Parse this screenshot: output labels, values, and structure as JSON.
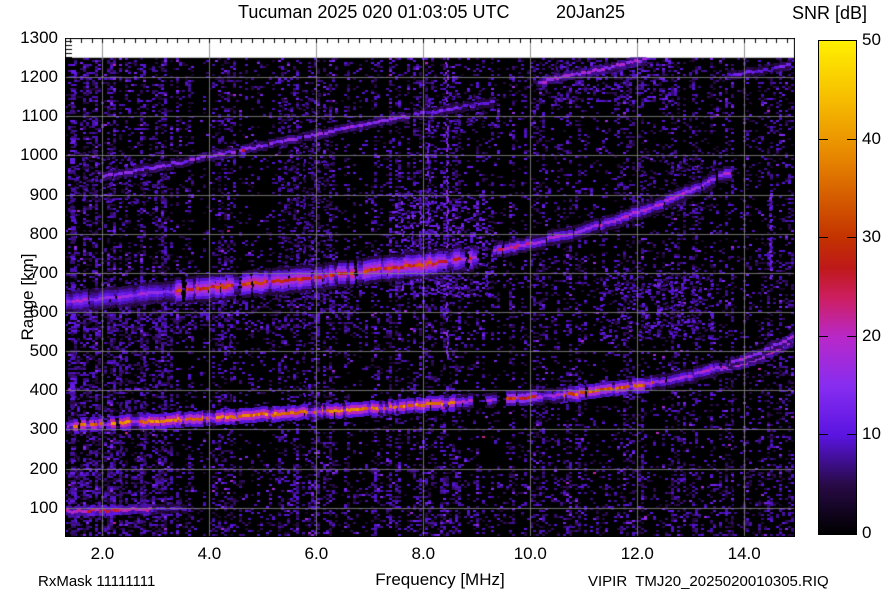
{
  "header": {
    "title": "Tucuman 2025 020 01:03:05 UTC",
    "date": "20Jan25"
  },
  "colorbar": {
    "title": "SNR [dB]",
    "tick_labels": [
      "0",
      "10",
      "20",
      "30",
      "40",
      "50"
    ],
    "tick_values": [
      0,
      10,
      20,
      30,
      40,
      50
    ],
    "mark_values": [
      10,
      20,
      30,
      40
    ]
  },
  "footer": {
    "left": "RxMask 11111111",
    "right": "VIPIR  TMJ20_2025020010305.RIQ"
  },
  "chart_data": {
    "type": "heatmap",
    "title": "Tucuman 2025 020 01:03:05 UTC",
    "xlabel": "Frequency [MHz]",
    "ylabel": "Range [km]",
    "zlabel": "SNR [dB]",
    "xlim": [
      1.3,
      14.95
    ],
    "ylim": [
      25,
      1300
    ],
    "zlim": [
      0,
      50
    ],
    "grid": true,
    "grid_color_rgba": "rgba(128,128,128,0.85)",
    "x_tick_labels": [
      "2.0",
      "4.0",
      "6.0",
      "8.0",
      "10.0",
      "12.0",
      "14.0"
    ],
    "x_tick_values": [
      2,
      4,
      6,
      8,
      10,
      12,
      14
    ],
    "x_minor_step": 0.2,
    "y_tick_labels": [
      "100",
      "200",
      "300",
      "400",
      "500",
      "600",
      "700",
      "800",
      "900",
      "1000",
      "1100",
      "1200",
      "1300"
    ],
    "y_tick_values": [
      100,
      200,
      300,
      400,
      500,
      600,
      700,
      800,
      900,
      1000,
      1100,
      1200,
      1300
    ],
    "data_top_km": 1250,
    "background_color": "#000000",
    "colormap_stops": [
      [
        0,
        0,
        0,
        0
      ],
      [
        5,
        40,
        10,
        70
      ],
      [
        10,
        90,
        20,
        225
      ],
      [
        15,
        135,
        45,
        240
      ],
      [
        20,
        185,
        40,
        200
      ],
      [
        24,
        205,
        30,
        95
      ],
      [
        27,
        190,
        25,
        25
      ],
      [
        30,
        195,
        50,
        0
      ],
      [
        38,
        230,
        132,
        0
      ],
      [
        44,
        246,
        188,
        0
      ],
      [
        50,
        255,
        240,
        0
      ]
    ],
    "noise": {
      "seed": 1337,
      "base_density": 0.16,
      "band_gains": [
        {
          "f0": 1.3,
          "f1": 3.2,
          "gain": 1.6
        },
        {
          "f0": 5.4,
          "f1": 6.3,
          "gain": 1.25
        },
        {
          "f0": 7.3,
          "f1": 8.8,
          "gain": 1.3
        },
        {
          "f0": 11.9,
          "f1": 13.3,
          "gain": 1.2
        },
        {
          "f0": 13.9,
          "f1": 14.95,
          "gain": 1.15
        }
      ],
      "row_gains": [
        {
          "r0": 25,
          "r1": 215,
          "gain": 1.5
        },
        {
          "r0": 530,
          "r1": 760,
          "gain": 1.3
        },
        {
          "r0": 1090,
          "r1": 1250,
          "gain": 1.2
        }
      ]
    },
    "traces": [
      {
        "name": "F-region first hop",
        "points": [
          [
            1.3,
            311
          ],
          [
            2,
            316
          ],
          [
            3,
            323
          ],
          [
            4,
            331
          ],
          [
            5,
            339
          ],
          [
            6,
            347
          ],
          [
            7,
            355
          ],
          [
            8,
            364
          ],
          [
            9,
            373
          ],
          [
            10,
            383
          ],
          [
            10.8,
            393
          ],
          [
            11.6,
            406
          ],
          [
            12.4,
            422
          ],
          [
            13.0,
            440
          ],
          [
            13.5,
            462
          ]
        ],
        "base_db": 16,
        "thickness_km": 14,
        "dash_w": 5,
        "hot": [
          [
            1.45,
            8.55,
            36
          ],
          [
            9.55,
            10.1,
            28
          ],
          [
            10.6,
            12.3,
            33
          ]
        ],
        "gaps": [
          [
            8.85,
            9.05
          ],
          [
            9.3,
            9.45
          ]
        ]
      },
      {
        "name": "F critical riser O",
        "points": [
          [
            13.55,
            455
          ],
          [
            14.0,
            470
          ],
          [
            14.4,
            492
          ],
          [
            14.75,
            515
          ],
          [
            14.95,
            530
          ]
        ],
        "base_db": 17,
        "thickness_km": 9,
        "dash_w": 5,
        "hot": [],
        "gaps": []
      },
      {
        "name": "F critical riser X",
        "points": [
          [
            13.7,
            470
          ],
          [
            14.1,
            488
          ],
          [
            14.5,
            512
          ],
          [
            14.85,
            537
          ],
          [
            14.95,
            545
          ]
        ],
        "base_db": 15,
        "thickness_km": 9,
        "dash_w": 5,
        "hot": [],
        "gaps": []
      },
      {
        "name": "E-region stripe",
        "points": [
          [
            1.3,
            92
          ],
          [
            2.0,
            94
          ],
          [
            2.9,
            97
          ]
        ],
        "base_db": 18,
        "thickness_km": 11,
        "dash_w": 6,
        "hot": [
          [
            1.7,
            2.3,
            24
          ]
        ],
        "gaps": []
      },
      {
        "name": "E-region faint ext",
        "points": [
          [
            2.9,
            97
          ],
          [
            3.5,
            99
          ]
        ],
        "base_db": 8,
        "thickness_km": 8,
        "dash_w": 5,
        "hot": [],
        "gaps": []
      },
      {
        "name": "second hop band",
        "points": [
          [
            1.3,
            627
          ],
          [
            2,
            636
          ],
          [
            3,
            650
          ],
          [
            4,
            663
          ],
          [
            5,
            677
          ],
          [
            6,
            691
          ],
          [
            7,
            707
          ],
          [
            8,
            723
          ],
          [
            8.9,
            741
          ]
        ],
        "base_db": 15,
        "thickness_km": 28,
        "dash_w": 5,
        "hot": [
          [
            3.3,
            8.85,
            29
          ]
        ],
        "gaps": []
      },
      {
        "name": "second hop upper",
        "points": [
          [
            9.3,
            757
          ],
          [
            10,
            777
          ],
          [
            10.7,
            800
          ],
          [
            11.5,
            832
          ],
          [
            12.3,
            872
          ],
          [
            13.1,
            920
          ],
          [
            13.7,
            962
          ]
        ],
        "base_db": 16,
        "thickness_km": 12,
        "dash_w": 5,
        "hot": [
          [
            9.3,
            9.95,
            21
          ]
        ],
        "gaps": []
      },
      {
        "name": "third hop",
        "points": [
          [
            2.0,
            947
          ],
          [
            3,
            972
          ],
          [
            4,
            999
          ],
          [
            5,
            1027
          ],
          [
            6,
            1055
          ],
          [
            7,
            1083
          ],
          [
            7.65,
            1100
          ]
        ],
        "base_db": 13,
        "thickness_km": 11,
        "dash_w": 5,
        "hot": [
          [
            4.35,
            4.6,
            27
          ]
        ],
        "gaps": []
      },
      {
        "name": "third hop ext",
        "points": [
          [
            7.75,
            1103
          ],
          [
            8.5,
            1120
          ],
          [
            9.3,
            1139
          ]
        ],
        "base_db": 10,
        "thickness_km": 9,
        "dash_w": 5,
        "hot": [],
        "gaps": []
      },
      {
        "name": "top right trace",
        "points": [
          [
            10.1,
            1186
          ],
          [
            10.7,
            1205
          ],
          [
            11.3,
            1222
          ],
          [
            11.9,
            1240
          ],
          [
            12.15,
            1248
          ]
        ],
        "base_db": 15,
        "thickness_km": 10,
        "dash_w": 5,
        "hot": [],
        "gaps": []
      },
      {
        "name": "top far right piece",
        "points": [
          [
            13.7,
            1206
          ],
          [
            14.3,
            1218
          ],
          [
            14.85,
            1232
          ]
        ],
        "base_db": 10,
        "thickness_km": 8,
        "dash_w": 5,
        "hot": [],
        "gaps": []
      }
    ],
    "rfi_streaks": [
      {
        "f": 1.45,
        "r0": 30,
        "r1": 1250,
        "db": 12,
        "w": 5,
        "density": 0.55
      },
      {
        "f": 2.35,
        "r0": 60,
        "r1": 560,
        "db": 9,
        "w": 3,
        "density": 0.4
      },
      {
        "f": 2.8,
        "r0": 60,
        "r1": 545,
        "db": 9,
        "w": 3,
        "density": 0.4
      },
      {
        "f": 4.4,
        "r0": 290,
        "r1": 560,
        "db": 8,
        "w": 2,
        "density": 0.3
      },
      {
        "f": 5.78,
        "r0": 350,
        "r1": 1010,
        "db": 11,
        "w": 2,
        "density": 0.5
      },
      {
        "f": 6.5,
        "r0": 590,
        "r1": 700,
        "db": 9,
        "w": 2,
        "density": 0.3
      },
      {
        "f": 7.62,
        "r0": 645,
        "r1": 905,
        "db": 16,
        "w": 2,
        "density": 0.75
      },
      {
        "f": 7.8,
        "r0": 655,
        "r1": 900,
        "db": 14,
        "w": 2,
        "density": 0.6
      },
      {
        "f": 7.95,
        "r0": 660,
        "r1": 905,
        "db": 15,
        "w": 2,
        "density": 0.65
      },
      {
        "f": 8.1,
        "r0": 650,
        "r1": 1150,
        "db": 14,
        "w": 2,
        "density": 0.6
      },
      {
        "f": 8.25,
        "r0": 655,
        "r1": 900,
        "db": 13,
        "w": 2,
        "density": 0.55
      },
      {
        "f": 8.45,
        "r0": 470,
        "r1": 1250,
        "db": 17,
        "w": 2,
        "density": 0.8
      },
      {
        "f": 8.65,
        "r0": 650,
        "r1": 830,
        "db": 13,
        "w": 2,
        "density": 0.5
      },
      {
        "f": 9.2,
        "r0": 645,
        "r1": 800,
        "db": 10,
        "w": 2,
        "density": 0.4
      },
      {
        "f": 9.85,
        "r0": 530,
        "r1": 625,
        "db": 9,
        "w": 2,
        "density": 0.3
      },
      {
        "f": 10.5,
        "r0": 1130,
        "r1": 1250,
        "db": 9,
        "w": 2,
        "density": 0.35
      },
      {
        "f": 11.25,
        "r0": 1140,
        "r1": 1250,
        "db": 10,
        "w": 2,
        "density": 0.4
      },
      {
        "f": 12.4,
        "r0": 535,
        "r1": 700,
        "db": 13,
        "w": 4,
        "density": 0.55
      },
      {
        "f": 12.65,
        "r0": 540,
        "r1": 690,
        "db": 12,
        "w": 3,
        "density": 0.5
      },
      {
        "f": 13.05,
        "r0": 545,
        "r1": 655,
        "db": 11,
        "w": 3,
        "density": 0.45
      },
      {
        "f": 13.78,
        "r0": 30,
        "r1": 560,
        "db": 8,
        "w": 2,
        "density": 0.3
      },
      {
        "f": 14.3,
        "r0": 575,
        "r1": 650,
        "db": 9,
        "w": 2,
        "density": 0.35
      },
      {
        "f": 14.5,
        "r0": 690,
        "r1": 905,
        "db": 16,
        "w": 3,
        "density": 0.8
      }
    ],
    "diffuse_patches": [
      {
        "f0": 7.35,
        "f1": 9.3,
        "r0": 640,
        "r1": 910,
        "density": 0.3,
        "db_lo": 4,
        "db_hi": 14
      },
      {
        "f0": 10.5,
        "f1": 12.6,
        "r0": 1140,
        "r1": 1250,
        "density": 0.28,
        "db_lo": 4,
        "db_hi": 12
      },
      {
        "f0": 7.9,
        "f1": 9.4,
        "r0": 1060,
        "r1": 1160,
        "density": 0.18,
        "db_lo": 3,
        "db_hi": 10
      },
      {
        "f0": 1.4,
        "f1": 3.1,
        "r0": 880,
        "r1": 1010,
        "density": 0.2,
        "db_lo": 3,
        "db_hi": 10
      },
      {
        "f0": 11.3,
        "f1": 13.4,
        "r0": 530,
        "r1": 700,
        "density": 0.22,
        "db_lo": 4,
        "db_hi": 12
      },
      {
        "f0": 1.35,
        "f1": 6.8,
        "r0": 555,
        "r1": 662,
        "density": 0.28,
        "db_lo": 3,
        "db_hi": 11
      },
      {
        "f0": 1.35,
        "f1": 3.3,
        "r0": 40,
        "r1": 560,
        "density": 0.2,
        "db_lo": 3,
        "db_hi": 10
      },
      {
        "f0": 5.3,
        "f1": 6.3,
        "r0": 640,
        "r1": 1160,
        "density": 0.15,
        "db_lo": 3,
        "db_hi": 9
      },
      {
        "f0": 9.6,
        "f1": 10.4,
        "r0": 1150,
        "r1": 1250,
        "density": 0.13,
        "db_lo": 3,
        "db_hi": 9
      },
      {
        "f0": 12.0,
        "f1": 13.6,
        "r0": 860,
        "r1": 1010,
        "density": 0.13,
        "db_lo": 3,
        "db_hi": 9
      }
    ]
  }
}
